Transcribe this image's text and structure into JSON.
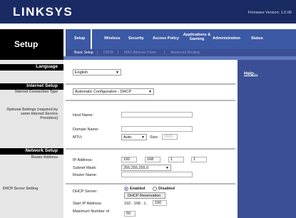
{
  "brand": {
    "logo": "LINKSYS",
    "firmware": "Firmware Version: 1.0.06"
  },
  "page": {
    "title": "Setup"
  },
  "tabs": [
    {
      "label": "Setup",
      "active": true
    },
    {
      "label": "Wireless"
    },
    {
      "label": "Security"
    },
    {
      "label": "Access Policy"
    },
    {
      "label": "Applications & Gaming"
    },
    {
      "label": "Administration"
    },
    {
      "label": "Status"
    }
  ],
  "subtabs": [
    {
      "label": "Basic Setup",
      "active": true
    },
    {
      "label": "DDNS"
    },
    {
      "label": "MAC Address Clone"
    },
    {
      "label": "Advanced Routing"
    }
  ],
  "subtab_separator": "|",
  "sections": {
    "language": "Language",
    "internet_setup": "Internet Setup",
    "internet_connection_type": "Internet Connection Type",
    "optional_settings": "Optional Settings (required by some Internet Service Providers)",
    "network_setup": "Network Setup",
    "router_address": "Router Address",
    "dhcp_server_setting": "DHCP Server Setting"
  },
  "language": {
    "value": "English"
  },
  "connection_type": {
    "value": "Automatic Configuration - DHCP"
  },
  "optional": {
    "host_name_label": "Host Name:",
    "host_name": "",
    "domain_name_label": "Domain Name:",
    "domain_name": "",
    "mtu_label": "MTU:",
    "mtu_mode": "Auto",
    "size_label": "Size:",
    "size": "1500"
  },
  "router": {
    "ip_label": "IP Address:",
    "ip": [
      "192",
      "168",
      "1",
      "1"
    ],
    "mask_label": "Subnet Mask:",
    "mask": "255.255.255.0",
    "name_label": "Router Name:",
    "name": ""
  },
  "dhcp": {
    "server_label": "DHCP Server:",
    "enabled_label": "Enabled",
    "disabled_label": "Disabled",
    "reservation_button": "DHCP Reservation",
    "start_ip_label": "Start IP  Address:",
    "start_ip_prefix": "192 . 168 . 1 .",
    "start_ip_last": "100",
    "max_users_label": "Maximum Number of",
    "max_users": "50"
  },
  "help": {
    "label": "Help..."
  },
  "icons": {
    "caret": "chevron-down-icon",
    "radio_selected": "radio-selected-icon"
  },
  "colors": {
    "header": "#1a2b63",
    "tabbar": "#3b59a4",
    "subbar": "#3a4f95",
    "section_bar": "#000000",
    "left_panel": "#e6e6e6"
  }
}
